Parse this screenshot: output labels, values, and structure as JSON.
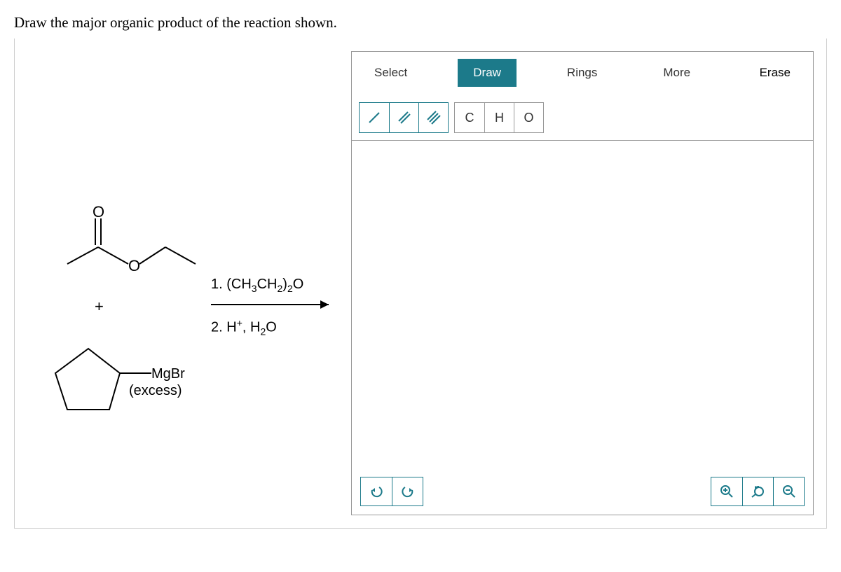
{
  "prompt": "Draw the major organic product of the reaction shown.",
  "toolbar": {
    "select_label": "Select",
    "draw_label": "Draw",
    "rings_label": "Rings",
    "more_label": "More",
    "erase_label": "Erase",
    "atoms": {
      "c": "C",
      "h": "H",
      "o": "O"
    }
  },
  "reaction": {
    "plus": "+",
    "reagent1_prefix": "1. (CH",
    "reagent1_sub1": "3",
    "reagent1_mid": "CH",
    "reagent1_sub2": "2",
    "reagent1_mid2": ")",
    "reagent1_sub3": "2",
    "reagent1_end": "O",
    "reagent2_prefix": "2. H",
    "reagent2_sup": "+",
    "reagent2_mid": ", H",
    "reagent2_sub": "2",
    "reagent2_end": "O",
    "grignard": "MgBr",
    "excess": "(excess)"
  }
}
